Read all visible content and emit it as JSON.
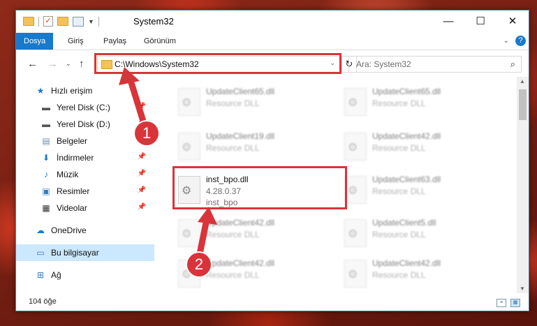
{
  "window": {
    "title": "System32",
    "buttons": {
      "minimize": "—",
      "maximize": "☐",
      "close": "✕"
    }
  },
  "ribbon": {
    "tabs": [
      "Dosya",
      "Giriş",
      "Paylaş",
      "Görünüm"
    ],
    "help": "?"
  },
  "address": {
    "path": "C:\\Windows\\System32",
    "search_placeholder": "Ara: System32"
  },
  "nav": {
    "items": [
      {
        "label": "Hızlı erişim",
        "icon": "star-icon",
        "pinned": false
      },
      {
        "label": "Yerel Disk (C:)",
        "icon": "drive-icon",
        "pinned": true
      },
      {
        "label": "Yerel Disk (D:)",
        "icon": "drive-icon",
        "pinned": true
      },
      {
        "label": "Belgeler",
        "icon": "documents-icon",
        "pinned": true
      },
      {
        "label": "İndirmeler",
        "icon": "download-icon",
        "pinned": true
      },
      {
        "label": "Müzik",
        "icon": "music-icon",
        "pinned": true
      },
      {
        "label": "Resimler",
        "icon": "pictures-icon",
        "pinned": true
      },
      {
        "label": "Videolar",
        "icon": "videos-icon",
        "pinned": true
      },
      {
        "label": "OneDrive",
        "icon": "cloud-icon",
        "pinned": false
      },
      {
        "label": "Bu bilgisayar",
        "icon": "computer-icon",
        "pinned": false
      },
      {
        "label": "Ağ",
        "icon": "network-icon",
        "pinned": false
      }
    ]
  },
  "files": {
    "left": [
      {
        "name": "UpdateClient65.dll",
        "line2": "Resource DLL",
        "line3": ""
      },
      {
        "name": "UpdateClient19.dll",
        "line2": "Resource DLL",
        "line3": ""
      },
      {
        "name": "inst_bpo.dll",
        "line2": "4.28.0.37",
        "line3": "inst_bpo"
      },
      {
        "name": "UpdateClient42.dll",
        "line2": "Resource DLL",
        "line3": ""
      },
      {
        "name": "UpdateClient42.dll",
        "line2": "Resource DLL",
        "line3": ""
      }
    ],
    "right": [
      {
        "name": "UpdateClient65.dll",
        "line2": "Resource DLL"
      },
      {
        "name": "UpdateClient42.dll",
        "line2": "Resource DLL"
      },
      {
        "name": "UpdateClient63.dll",
        "line2": "Resource DLL"
      },
      {
        "name": "UpdateClient5.dll",
        "line2": "Resource DLL"
      },
      {
        "name": "UpdateClient42.dll",
        "line2": "Resource DLL"
      }
    ]
  },
  "status": {
    "count": "104 öğe"
  },
  "annotations": {
    "step1": "1",
    "step2": "2"
  },
  "colors": {
    "accent": "#1979ca",
    "highlight": "#d8343a",
    "selected": "#cce8ff"
  }
}
